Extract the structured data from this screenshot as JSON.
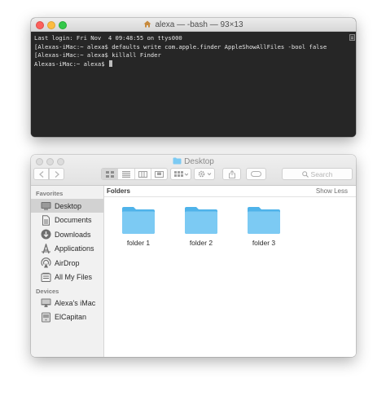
{
  "terminal": {
    "title": "alexa — -bash — 93×13",
    "lines": [
      "Last login: Fri Nov  4 09:48:55 on ttys000",
      "[Alexas-iMac:~ alexa$ defaults write com.apple.finder AppleShowAllFiles -bool false",
      "[Alexas-iMac:~ alexa$ killall Finder",
      "Alexas-iMac:~ alexa$ "
    ],
    "colors": {
      "background": "#262626",
      "text": "#e6e6e6"
    }
  },
  "finder": {
    "title": "Desktop",
    "search_placeholder": "Search",
    "sidebar": {
      "favorites_heading": "Favorites",
      "favorites": [
        {
          "label": "Desktop",
          "icon": "desktop-icon",
          "selected": true
        },
        {
          "label": "Documents",
          "icon": "documents-icon"
        },
        {
          "label": "Downloads",
          "icon": "downloads-icon"
        },
        {
          "label": "Applications",
          "icon": "applications-icon"
        },
        {
          "label": "AirDrop",
          "icon": "airdrop-icon"
        },
        {
          "label": "All My Files",
          "icon": "all-my-files-icon"
        }
      ],
      "devices_heading": "Devices",
      "devices": [
        {
          "label": "Alexa's iMac",
          "icon": "imac-icon"
        },
        {
          "label": "ElCapitan",
          "icon": "disk-icon"
        }
      ]
    },
    "content": {
      "section_title": "Folders",
      "show_less": "Show Less",
      "folders": [
        "folder 1",
        "folder 2",
        "folder 3"
      ]
    },
    "colors": {
      "folder": "#6cc4f2",
      "sidebar": "#f1f1f1",
      "selection": "#d2d2d2"
    }
  }
}
